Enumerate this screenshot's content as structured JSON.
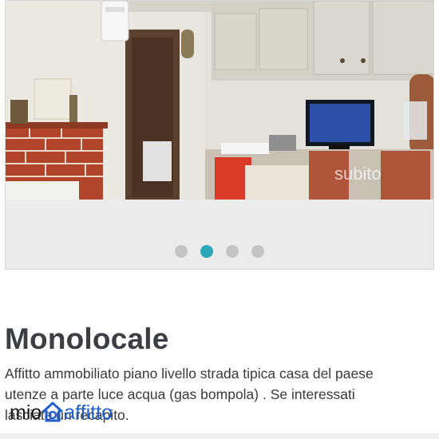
{
  "gallery": {
    "watermark": "subito",
    "slide_count": 4,
    "active_slide_index": 1,
    "dots": [
      {
        "label": "slide-1",
        "active": false
      },
      {
        "label": "slide-2",
        "active": true
      },
      {
        "label": "slide-3",
        "active": false
      },
      {
        "label": "slide-4",
        "active": false
      }
    ],
    "active_dot_color": "#2aa7b8",
    "inactive_dot_color": "#c4c4c4"
  },
  "listing": {
    "title": "Monolocale",
    "description_lines": [
      "Affitto ammobiliato piano livello strada tipica casa del paese",
      "utenze a parte luce acqua (gas bompola) . Se interessati",
      "lasciate un recapito."
    ]
  },
  "logo": {
    "text_left": "mio",
    "text_right": "affitto",
    "brand_color": "#1f5fd0"
  }
}
